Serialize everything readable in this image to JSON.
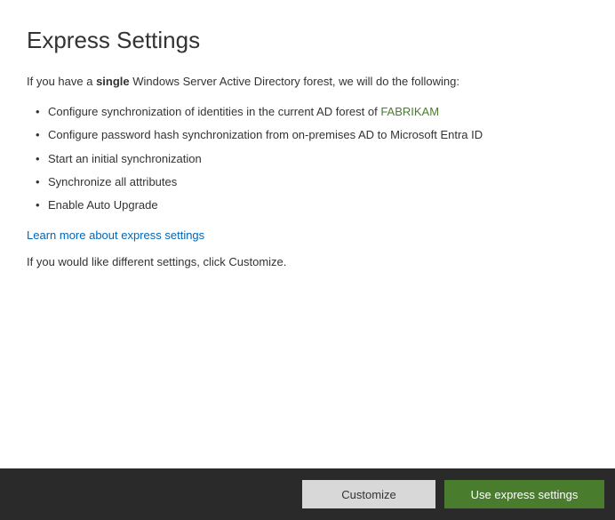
{
  "header": {
    "title": "Express Settings"
  },
  "intro": {
    "prefix": "If you have a ",
    "bold_word": "single",
    "suffix": " Windows Server Active Directory forest, we will do the following:"
  },
  "bullets": [
    {
      "text_prefix": "Configure synchronization of identities in the current AD forest of ",
      "forest_name": "FABRIKAM"
    },
    {
      "text": "Configure password hash synchronization from on-premises AD to Microsoft Entra ID"
    },
    {
      "text": "Start an initial synchronization"
    },
    {
      "text": "Synchronize all attributes"
    },
    {
      "text": "Enable Auto Upgrade"
    }
  ],
  "learn_more": {
    "label": "Learn more about express settings"
  },
  "customize_note": "If you would like different settings, click Customize.",
  "footer": {
    "customize_label": "Customize",
    "express_label": "Use express settings"
  }
}
